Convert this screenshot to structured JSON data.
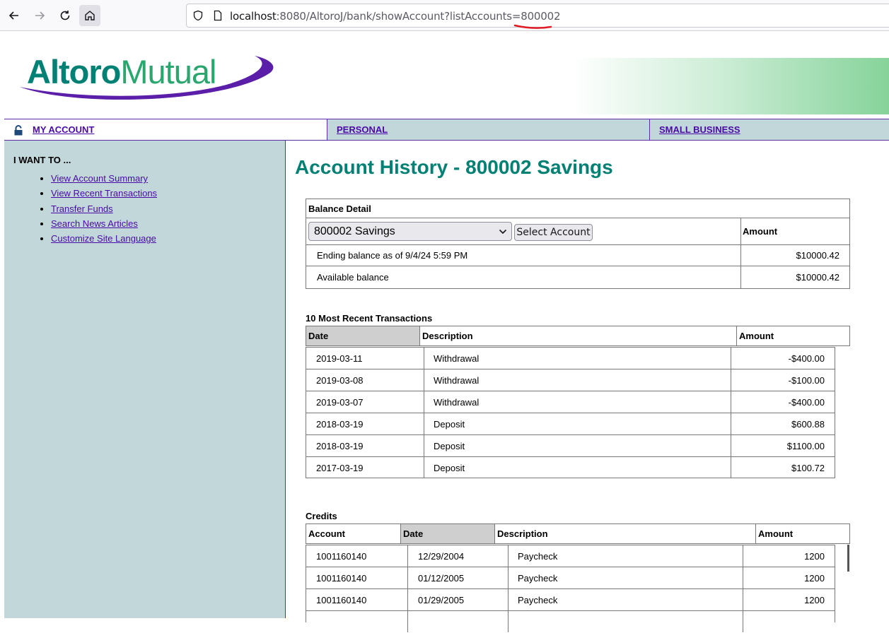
{
  "browser": {
    "url_host": "localhost",
    "url_rest": ":8080/AltoroJ/bank/showAccount?listAccounts=800002"
  },
  "header": {
    "logo_bold": "Altoro",
    "logo_light": "Mutual"
  },
  "tabs": {
    "my_account": "MY ACCOUNT",
    "personal": "PERSONAL",
    "small_business": "SMALL BUSINESS"
  },
  "sidebar": {
    "title": "I WANT TO ...",
    "items": [
      "View Account Summary",
      "View Recent Transactions",
      "Transfer Funds",
      "Search News Articles",
      "Customize Site Language"
    ]
  },
  "main": {
    "title": "Account History - 800002 Savings",
    "balance": {
      "header": "Balance Detail",
      "selected_account": "800002 Savings",
      "select_button": "Select Account",
      "amount_header": "Amount",
      "rows": [
        {
          "label": "Ending balance as of 9/4/24 5:59 PM",
          "amount": "$10000.42"
        },
        {
          "label": "Available balance",
          "amount": "$10000.42"
        }
      ]
    },
    "recent": {
      "label": "10 Most Recent Transactions",
      "headers": [
        "Date",
        "Description",
        "Amount"
      ],
      "rows": [
        {
          "date": "2019-03-11",
          "desc": "Withdrawal",
          "amount": "-$400.00"
        },
        {
          "date": "2019-03-08",
          "desc": "Withdrawal",
          "amount": "-$100.00"
        },
        {
          "date": "2019-03-07",
          "desc": "Withdrawal",
          "amount": "-$400.00"
        },
        {
          "date": "2018-03-19",
          "desc": "Deposit",
          "amount": "$600.88"
        },
        {
          "date": "2018-03-19",
          "desc": "Deposit",
          "amount": "$1100.00"
        },
        {
          "date": "2017-03-19",
          "desc": "Deposit",
          "amount": "$100.72"
        }
      ]
    },
    "credits": {
      "label": "Credits",
      "headers": [
        "Account",
        "Date",
        "Description",
        "Amount"
      ],
      "rows": [
        {
          "account": "1001160140",
          "date": "12/29/2004",
          "desc": "Paycheck",
          "amount": "1200"
        },
        {
          "account": "1001160140",
          "date": "01/12/2005",
          "desc": "Paycheck",
          "amount": "1200"
        },
        {
          "account": "1001160140",
          "date": "01/29/2005",
          "desc": "Paycheck",
          "amount": "1200"
        }
      ]
    }
  }
}
